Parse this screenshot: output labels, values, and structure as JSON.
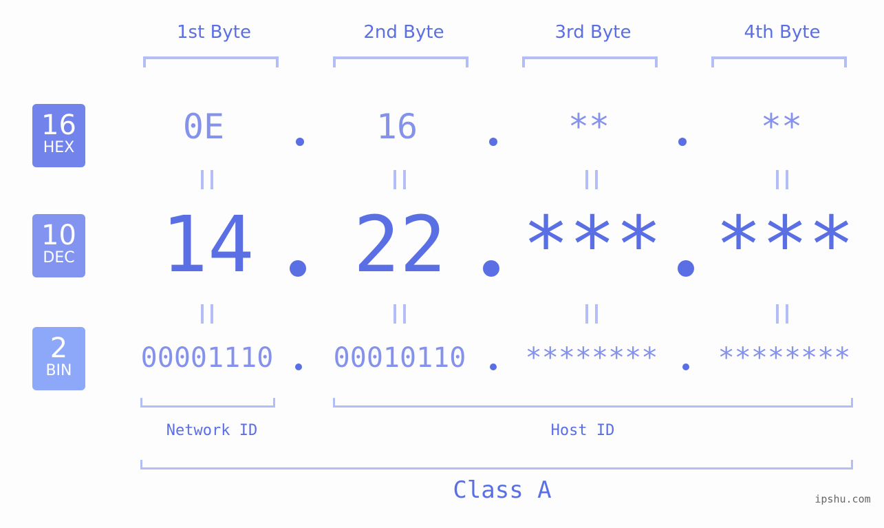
{
  "byte_headers": [
    "1st Byte",
    "2nd Byte",
    "3rd Byte",
    "4th Byte"
  ],
  "badges": {
    "hex": {
      "number": "16",
      "label": "HEX"
    },
    "dec": {
      "number": "10",
      "label": "DEC"
    },
    "bin": {
      "number": "2",
      "label": "BIN"
    }
  },
  "hex_values": [
    "0E",
    "16",
    "**",
    "**"
  ],
  "dec_values": [
    "14",
    "22",
    "***",
    "***"
  ],
  "bin_values": [
    "00001110",
    "00010110",
    "********",
    "********"
  ],
  "network_id_label": "Network ID",
  "host_id_label": "Host ID",
  "class_label": "Class A",
  "watermark": "ipshu.com",
  "colors": {
    "accent": "#5a6fe4",
    "light_value": "#8592ec",
    "bracket": "#b3bdf6",
    "hex_badge": "#7383ec",
    "dec_badge": "#8294f0",
    "bin_badge": "#8da8f8"
  }
}
